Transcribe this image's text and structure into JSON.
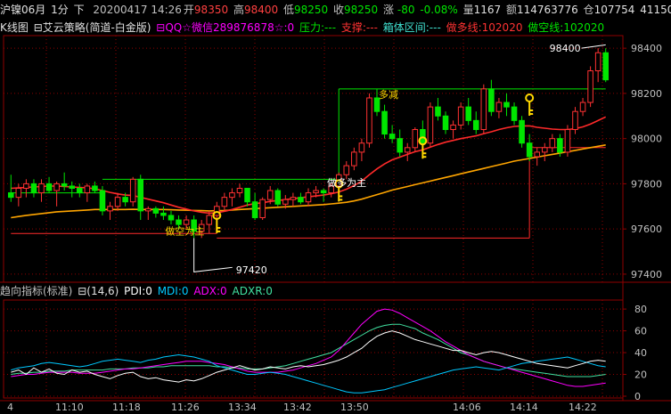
{
  "colors": {
    "background": "#000000",
    "up": "#ff3232",
    "down": "#00e600",
    "ma_fast": "#ff2a2a",
    "ma_slow": "#ffa500",
    "support_line": "#ff2a2a",
    "pressure_line": "#00e600",
    "grid": "#900000",
    "axis_text": "#c0c0c0",
    "pdi": "#ffffff",
    "mdi": "#00c8ff",
    "adx": "#ff00ff",
    "adxr": "#40e0a0"
  },
  "titlebar": {
    "symbol": "沪镍06月",
    "period": "1分",
    "arrow": "下",
    "datetime": "20200417 14:26",
    "open_label": "开",
    "open": "98350",
    "high_label": "高",
    "high": "98400",
    "low_label": "低",
    "low": "98250",
    "close_label": "收",
    "close": "98250",
    "chg_label": "涨",
    "chg": "-80",
    "pct": "-0.08%",
    "vol_label": "量",
    "vol": "1167",
    "amt_label": "额",
    "amt": "114763776",
    "oi_label": "仓",
    "oi": "107754",
    "settle": "41150"
  },
  "legend": {
    "kline": "K线图",
    "icon": "⊟",
    "strategy": "艾云策略(简道-白金版)",
    "qq": "⊟QQ☆微信289876878☆:0",
    "pressure": "压力:---",
    "support": "支撑:---",
    "box": "箱体区间:---",
    "long_line": "做多线:102020",
    "short_line": "做空线:102020"
  },
  "price_axis": [
    "98400",
    "98200",
    "98000",
    "97800",
    "97600",
    "97400"
  ],
  "ind_axis": [
    "80",
    "60",
    "40",
    "20",
    "0"
  ],
  "time_axis": [
    "4",
    "11:10",
    "11:18",
    "11:26",
    "13:34",
    "13:42",
    "13:50",
    "14:06",
    "14:14",
    "14:22"
  ],
  "annotations": {
    "high_label": "98400",
    "low_label": "97420",
    "short_main_1": "做空为主",
    "long_main": "做多为主",
    "long_reduce": "多减"
  },
  "indicator": {
    "title": "趋向指标(标准)",
    "params": "⊟(14,6)",
    "pdi": "PDI:0",
    "mdi": "MDI:0",
    "adx": "ADX:0",
    "adxr": "ADXR:0"
  },
  "chart_data": {
    "type": "candlestick",
    "ylim": [
      97380,
      98440
    ],
    "candles": [
      [
        97760,
        97840,
        97720,
        97740
      ],
      [
        97740,
        97800,
        97700,
        97780
      ],
      [
        97780,
        97820,
        97740,
        97800
      ],
      [
        97800,
        97820,
        97740,
        97760
      ],
      [
        97760,
        97820,
        97720,
        97800
      ],
      [
        97800,
        97830,
        97760,
        97770
      ],
      [
        97770,
        97810,
        97700,
        97800
      ],
      [
        97800,
        97850,
        97770,
        97790
      ],
      [
        97790,
        97810,
        97740,
        97780
      ],
      [
        97780,
        97800,
        97740,
        97760
      ],
      [
        97760,
        97800,
        97720,
        97790
      ],
      [
        97790,
        97810,
        97760,
        97770
      ],
      [
        97770,
        97790,
        97660,
        97680
      ],
      [
        97680,
        97720,
        97640,
        97700
      ],
      [
        97700,
        97760,
        97680,
        97740
      ],
      [
        97740,
        97760,
        97700,
        97720
      ],
      [
        97720,
        97830,
        97700,
        97820
      ],
      [
        97820,
        97840,
        97640,
        97680
      ],
      [
        97680,
        97700,
        97640,
        97690
      ],
      [
        97690,
        97700,
        97650,
        97670
      ],
      [
        97670,
        97700,
        97640,
        97660
      ],
      [
        97660,
        97680,
        97620,
        97640
      ],
      [
        97640,
        97660,
        97600,
        97620
      ],
      [
        97620,
        97660,
        97600,
        97640
      ],
      [
        97640,
        97660,
        97560,
        97590
      ],
      [
        97590,
        97640,
        97560,
        97620
      ],
      [
        97620,
        97680,
        97580,
        97660
      ],
      [
        97660,
        97720,
        97630,
        97700
      ],
      [
        97700,
        97760,
        97680,
        97740
      ],
      [
        97740,
        97780,
        97700,
        97760
      ],
      [
        97760,
        97800,
        97740,
        97780
      ],
      [
        97780,
        97780,
        97700,
        97720
      ],
      [
        97720,
        97760,
        97640,
        97650
      ],
      [
        97650,
        97740,
        97640,
        97730
      ],
      [
        97730,
        97790,
        97710,
        97770
      ],
      [
        97770,
        97780,
        97700,
        97710
      ],
      [
        97710,
        97750,
        97690,
        97730
      ],
      [
        97730,
        97760,
        97700,
        97740
      ],
      [
        97740,
        97760,
        97710,
        97720
      ],
      [
        97720,
        97780,
        97700,
        97760
      ],
      [
        97760,
        97790,
        97740,
        97770
      ],
      [
        97770,
        97780,
        97720,
        97760
      ],
      [
        97760,
        97800,
        97740,
        97790
      ],
      [
        97790,
        97850,
        97780,
        97840
      ],
      [
        97840,
        97900,
        97820,
        97880
      ],
      [
        97880,
        97960,
        97860,
        97940
      ],
      [
        97940,
        98000,
        97900,
        97980
      ],
      [
        97980,
        98200,
        97960,
        98180
      ],
      [
        98180,
        98220,
        98100,
        98120
      ],
      [
        98120,
        98150,
        98000,
        98020
      ],
      [
        98020,
        98060,
        97980,
        98000
      ],
      [
        98000,
        98040,
        97920,
        97940
      ],
      [
        97940,
        97980,
        97900,
        97960
      ],
      [
        97960,
        98050,
        97940,
        98040
      ],
      [
        98040,
        98080,
        97960,
        97980
      ],
      [
        97980,
        98160,
        97960,
        98140
      ],
      [
        98140,
        98180,
        98080,
        98100
      ],
      [
        98100,
        98120,
        98020,
        98040
      ],
      [
        98040,
        98080,
        98000,
        98060
      ],
      [
        98060,
        98160,
        98040,
        98140
      ],
      [
        98140,
        98180,
        98060,
        98080
      ],
      [
        98080,
        98120,
        98020,
        98040
      ],
      [
        98040,
        98240,
        98020,
        98220
      ],
      [
        98220,
        98260,
        98100,
        98120
      ],
      [
        98120,
        98180,
        98090,
        98160
      ],
      [
        98160,
        98200,
        98100,
        98140
      ],
      [
        98140,
        98160,
        98060,
        98080
      ],
      [
        98080,
        98100,
        97960,
        97980
      ],
      [
        97980,
        98020,
        97900,
        97920
      ],
      [
        97920,
        97960,
        97880,
        97940
      ],
      [
        97940,
        97980,
        97900,
        97960
      ],
      [
        97960,
        98020,
        97940,
        98000
      ],
      [
        98000,
        98020,
        97920,
        97940
      ],
      [
        97940,
        98060,
        97920,
        98040
      ],
      [
        98040,
        98140,
        98020,
        98120
      ],
      [
        98120,
        98180,
        98100,
        98160
      ],
      [
        98160,
        98320,
        98140,
        98300
      ],
      [
        98300,
        98400,
        98250,
        98380
      ],
      [
        98380,
        98400,
        98250,
        98260
      ]
    ],
    "ma_fast": [
      97780,
      97782,
      97784,
      97786,
      97788,
      97790,
      97790,
      97788,
      97786,
      97784,
      97782,
      97778,
      97770,
      97762,
      97755,
      97750,
      97748,
      97740,
      97732,
      97724,
      97716,
      97706,
      97696,
      97688,
      97680,
      97674,
      97670,
      97672,
      97678,
      97686,
      97696,
      97706,
      97712,
      97716,
      97722,
      97726,
      97730,
      97734,
      97738,
      97742,
      97746,
      97750,
      97756,
      97764,
      97776,
      97792,
      97812,
      97840,
      97866,
      97888,
      97906,
      97918,
      97930,
      97942,
      97950,
      97962,
      97974,
      97984,
      97992,
      98000,
      98006,
      98012,
      98022,
      98030,
      98040,
      98048,
      98054,
      98056,
      98056,
      98050,
      98046,
      98042,
      98040,
      98040,
      98044,
      98052,
      98064,
      98080,
      98096
    ],
    "ma_slow": [
      97650,
      97655,
      97660,
      97664,
      97668,
      97672,
      97676,
      97678,
      97680,
      97682,
      97684,
      97686,
      97686,
      97686,
      97686,
      97686,
      97687,
      97686,
      97686,
      97686,
      97686,
      97685,
      97684,
      97683,
      97682,
      97681,
      97680,
      97681,
      97682,
      97684,
      97686,
      97688,
      97690,
      97692,
      97694,
      97696,
      97698,
      97700,
      97702,
      97704,
      97706,
      97708,
      97711,
      97714,
      97718,
      97724,
      97732,
      97742,
      97752,
      97762,
      97772,
      97780,
      97788,
      97796,
      97804,
      97812,
      97820,
      97828,
      97836,
      97844,
      97852,
      97860,
      97868,
      97876,
      97884,
      97892,
      97900,
      97906,
      97912,
      97918,
      97924,
      97930,
      97936,
      97942,
      97948,
      97954,
      97960,
      97966,
      97972
    ],
    "pdi": [
      22,
      24,
      20,
      26,
      22,
      25,
      21,
      20,
      24,
      22,
      23,
      20,
      18,
      16,
      19,
      21,
      22,
      18,
      16,
      17,
      15,
      14,
      13,
      15,
      14,
      16,
      19,
      22,
      24,
      26,
      28,
      26,
      24,
      25,
      27,
      26,
      25,
      27,
      28,
      27,
      28,
      29,
      31,
      33,
      36,
      40,
      44,
      50,
      55,
      58,
      60,
      58,
      55,
      52,
      50,
      48,
      46,
      44,
      42,
      42,
      40,
      38,
      40,
      41,
      40,
      38,
      36,
      34,
      32,
      30,
      29,
      28,
      27,
      26,
      28,
      30,
      32,
      33,
      32
    ],
    "mdi": [
      24,
      26,
      27,
      28,
      30,
      31,
      30,
      29,
      28,
      27,
      28,
      30,
      32,
      33,
      34,
      33,
      32,
      31,
      33,
      34,
      36,
      37,
      38,
      37,
      36,
      34,
      32,
      28,
      26,
      24,
      22,
      20,
      20,
      21,
      22,
      21,
      20,
      18,
      16,
      14,
      12,
      10,
      8,
      6,
      4,
      3,
      3,
      4,
      5,
      6,
      8,
      10,
      12,
      14,
      16,
      18,
      20,
      22,
      24,
      25,
      26,
      27,
      26,
      25,
      24,
      26,
      28,
      30,
      31,
      32,
      33,
      34,
      35,
      36,
      34,
      32,
      30,
      28,
      27
    ],
    "adx": [
      18,
      19,
      20,
      20,
      21,
      22,
      22,
      22,
      22,
      21,
      21,
      21,
      22,
      23,
      24,
      25,
      25,
      26,
      27,
      28,
      29,
      30,
      31,
      32,
      32,
      32,
      31,
      30,
      29,
      27,
      25,
      23,
      22,
      22,
      22,
      22,
      23,
      24,
      26,
      28,
      30,
      33,
      36,
      42,
      50,
      58,
      66,
      72,
      78,
      80,
      79,
      76,
      72,
      68,
      64,
      60,
      55,
      50,
      46,
      42,
      38,
      35,
      32,
      30,
      28,
      26,
      24,
      22,
      20,
      18,
      16,
      14,
      12,
      10,
      9,
      9,
      10,
      11,
      12
    ],
    "adxr": [
      20,
      21,
      21,
      22,
      22,
      23,
      23,
      23,
      24,
      24,
      24,
      24,
      24,
      25,
      25,
      25,
      26,
      26,
      26,
      27,
      27,
      28,
      28,
      28,
      28,
      28,
      28,
      27,
      27,
      26,
      26,
      25,
      25,
      25,
      26,
      27,
      28,
      30,
      32,
      34,
      36,
      38,
      40,
      44,
      48,
      52,
      56,
      60,
      63,
      65,
      66,
      66,
      64,
      62,
      58,
      55,
      52,
      48,
      44,
      40,
      38,
      35,
      32,
      30,
      28,
      26,
      25,
      24,
      23,
      22,
      21,
      20,
      19,
      18,
      18,
      18,
      18,
      19,
      20
    ]
  }
}
